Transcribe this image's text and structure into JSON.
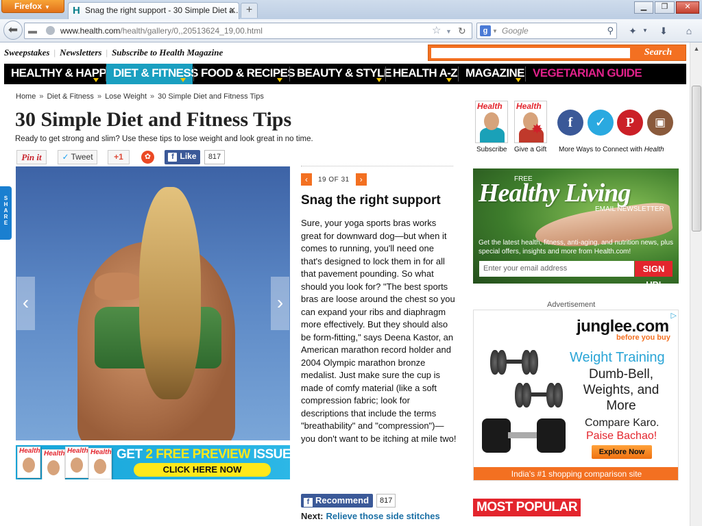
{
  "browser": {
    "app_button": "Firefox",
    "tab_title": "Snag the right support - 30 Simple Diet a...",
    "tab_favicon": "H",
    "new_tab": "+",
    "url_domain": "www.health.com",
    "url_path": "/health/gallery/0,,20513624_19,00.html",
    "search_placeholder": "Google",
    "search_engine_icon": "g",
    "colors": {
      "firefox_orange": "#e8801f",
      "chrome_bg": "#dce6f2"
    }
  },
  "site": {
    "utility_links": [
      "Sweepstakes",
      "Newsletters",
      "Subscribe to Health Magazine"
    ],
    "search_button": "Search",
    "nav": [
      {
        "label": "HEALTHY & HAPPY",
        "active": false
      },
      {
        "label": "DIET & FITNESS",
        "active": true
      },
      {
        "label": "FOOD & RECIPES",
        "active": false
      },
      {
        "label": "BEAUTY & STYLE",
        "active": false
      },
      {
        "label": "HEALTH A-Z",
        "active": false
      },
      {
        "label": "MAGAZINE",
        "active": false
      },
      {
        "label": "VEGETARIAN GUIDE",
        "active": false
      }
    ],
    "colors": {
      "nav_bg": "#000000",
      "nav_active": "#1a9fc0",
      "accent_orange": "#f37021",
      "veg_pink": "#e0218a"
    }
  },
  "article": {
    "breadcrumb": [
      "Home",
      "Diet & Fitness",
      "Lose Weight",
      "30 Simple Diet and Fitness Tips"
    ],
    "breadcrumb_sep": "»",
    "title": "30 Simple Diet and Fitness Tips",
    "subtitle": "Ready to get strong and slim? Use these tips to lose weight and look great in no time.",
    "share": {
      "pinterest": "Pin it",
      "tweet": "Tweet",
      "gplus": "+1",
      "like": "Like",
      "like_count": "817"
    },
    "share_tab": "SHARE",
    "slide_counter": "19 OF 31",
    "slide_title": "Snag the right support",
    "slide_body": "Sure, your yoga sports bras works great for downward dog—but when it comes to running, you'll need one that's designed to lock them in for all that pavement pounding. So what should you look for? \"The best sports bras are loose around the chest so you can expand your ribs and diaphragm more effectively. But they should also be form-fitting,\" says Deena Kastor, an American marathon record holder and 2004 Olympic marathon bronze medalist. Just make sure the cup is made of comfy material (like a soft compression fabric; look for descriptions that include the terms \"breathability\" and \"compression\")—you don't want to be itching at mile two!",
    "recommend": "Recommend",
    "recommend_count": "817",
    "next_label": "Next:",
    "next_link": "Relieve those side stitches",
    "promo": {
      "headline_pre": "GET",
      "headline_hi": "2 FREE PREVIEW",
      "headline_post": "ISSUES!",
      "cta": "CLICK HERE NOW",
      "cover_mast": "Health"
    }
  },
  "sidebar": {
    "cover_mast": "Health",
    "subscribe": "Subscribe",
    "give_gift": "Give a Gift",
    "more_ways": "More Ways to Connect with",
    "more_ways_brand": "Health",
    "social_icons": [
      "facebook-icon",
      "twitter-icon",
      "pinterest-icon",
      "instagram-icon"
    ],
    "newsletter": {
      "free": "FREE",
      "headline": "Healthy Living",
      "kicker": "EMAIL NEWSLETTER",
      "desc": "Get the latest health, fitness, anti-aging, and nutrition news, plus special offers, insights and more from Health.com!",
      "email_placeholder": "Enter your email address",
      "signup": "SIGN UP!"
    },
    "ad_label": "Advertisement",
    "ad": {
      "logo": "junglee.com",
      "tagline": "before you buy",
      "heading": "Weight Training",
      "lines": "Dumb-Bell, Weights, and More",
      "compare": "Compare Karo.",
      "paise": "Paise Bachao!",
      "explore": "Explore Now",
      "footer": "India's #1 shopping comparison site"
    },
    "most_popular": "MOST POPULAR"
  }
}
